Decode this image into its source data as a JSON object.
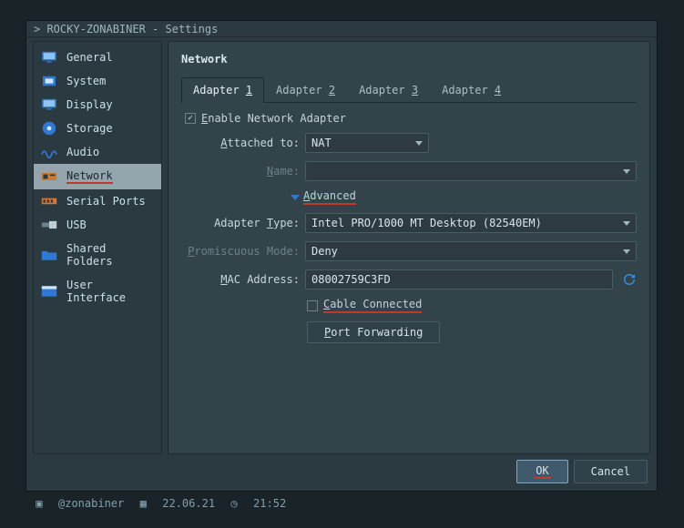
{
  "title": "> ROCKY-ZONABINER - Settings",
  "sidebar": {
    "items": [
      {
        "label": "General",
        "icon": "monitor"
      },
      {
        "label": "System",
        "icon": "chip"
      },
      {
        "label": "Display",
        "icon": "monitor"
      },
      {
        "label": "Storage",
        "icon": "disc"
      },
      {
        "label": "Audio",
        "icon": "waves"
      },
      {
        "label": "Network",
        "icon": "netcard",
        "active": true
      },
      {
        "label": "Serial Ports",
        "icon": "port"
      },
      {
        "label": "USB",
        "icon": "usb"
      },
      {
        "label": "Shared Folders",
        "icon": "folder"
      },
      {
        "label": "User Interface",
        "icon": "ui"
      }
    ]
  },
  "panel": {
    "title": "Network",
    "tabs": [
      {
        "prefix": "Adapter ",
        "num": "1",
        "active": true
      },
      {
        "prefix": "Adapter ",
        "num": "2"
      },
      {
        "prefix": "Adapter ",
        "num": "3"
      },
      {
        "prefix": "Adapter ",
        "num": "4"
      }
    ],
    "enable_label": "Enable Network Adapter",
    "enable_checked": true,
    "advanced_label": "Advanced",
    "fields": {
      "attached": {
        "label_pre": "A",
        "label_rest": "ttached to:",
        "value": "NAT"
      },
      "name": {
        "label_pre": "N",
        "label_rest": "ame:",
        "value": ""
      },
      "adapter_type": {
        "label_pre": "Adapter ",
        "label_u": "T",
        "label_post": "ype:",
        "value": "Intel PRO/1000 MT Desktop (82540EM)"
      },
      "promiscuous": {
        "label_pre": "P",
        "label_rest": "romiscuous Mode:",
        "value": "Deny"
      },
      "mac": {
        "label_pre": "M",
        "label_rest": "AC Address:",
        "value": "08002759C3FD"
      },
      "cable": {
        "label_pre": "C",
        "label_rest": "able Connected",
        "checked": false
      },
      "portfwd": {
        "label_pre": "P",
        "label_rest": "ort Forwarding"
      }
    }
  },
  "buttons": {
    "ok": "OK",
    "cancel": "Cancel"
  },
  "status": {
    "user": "@zonabiner",
    "date": "22.06.21",
    "time": "21:52"
  }
}
